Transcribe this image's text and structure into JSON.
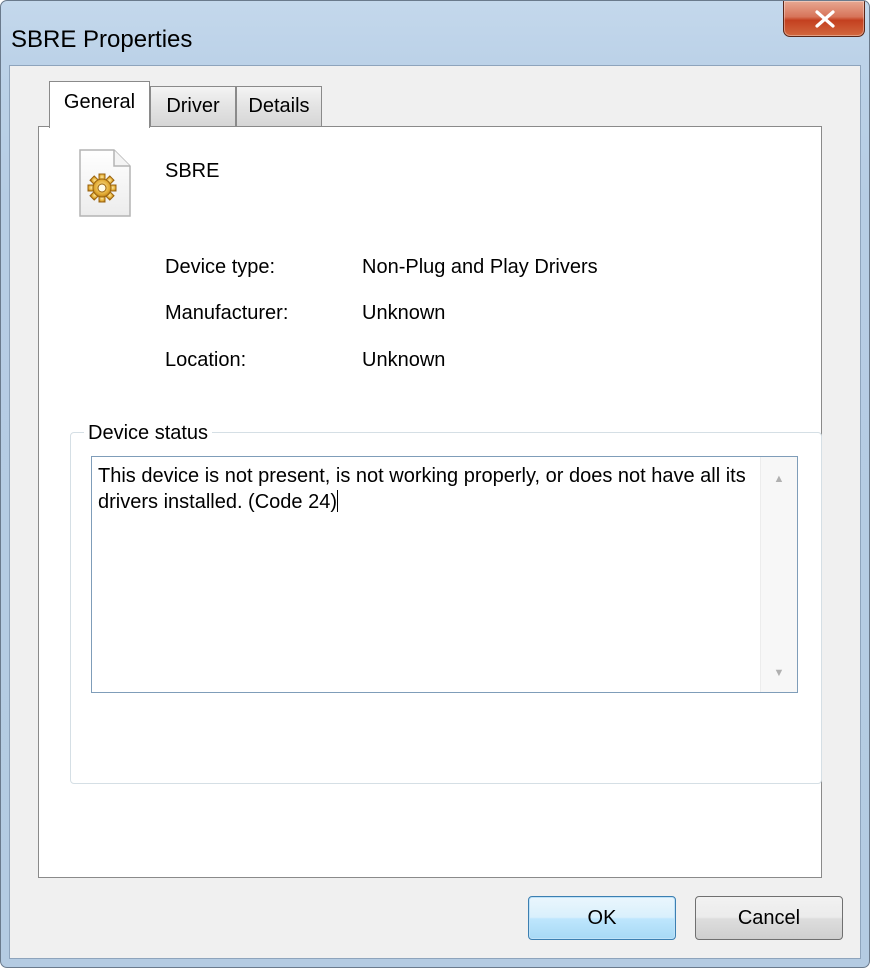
{
  "window": {
    "title": "SBRE Properties"
  },
  "tabs": [
    {
      "label": "General",
      "active": true
    },
    {
      "label": "Driver",
      "active": false
    },
    {
      "label": "Details",
      "active": false
    }
  ],
  "device": {
    "name": "SBRE",
    "icon": "gear-file-icon"
  },
  "properties": [
    {
      "label": "Device type:",
      "value": "Non-Plug and Play Drivers"
    },
    {
      "label": "Manufacturer:",
      "value": "Unknown"
    },
    {
      "label": "Location:",
      "value": "Unknown"
    }
  ],
  "status_group": {
    "title": "Device status",
    "text": "This device is not present, is not working properly, or does not have all its drivers installed. (Code 24)"
  },
  "buttons": {
    "ok": "OK",
    "cancel": "Cancel"
  },
  "colors": {
    "frame": "#b6cde4",
    "close_button": "#c4401f",
    "default_button_border": "#3c7fb1",
    "edit_border": "#7f9db9"
  }
}
